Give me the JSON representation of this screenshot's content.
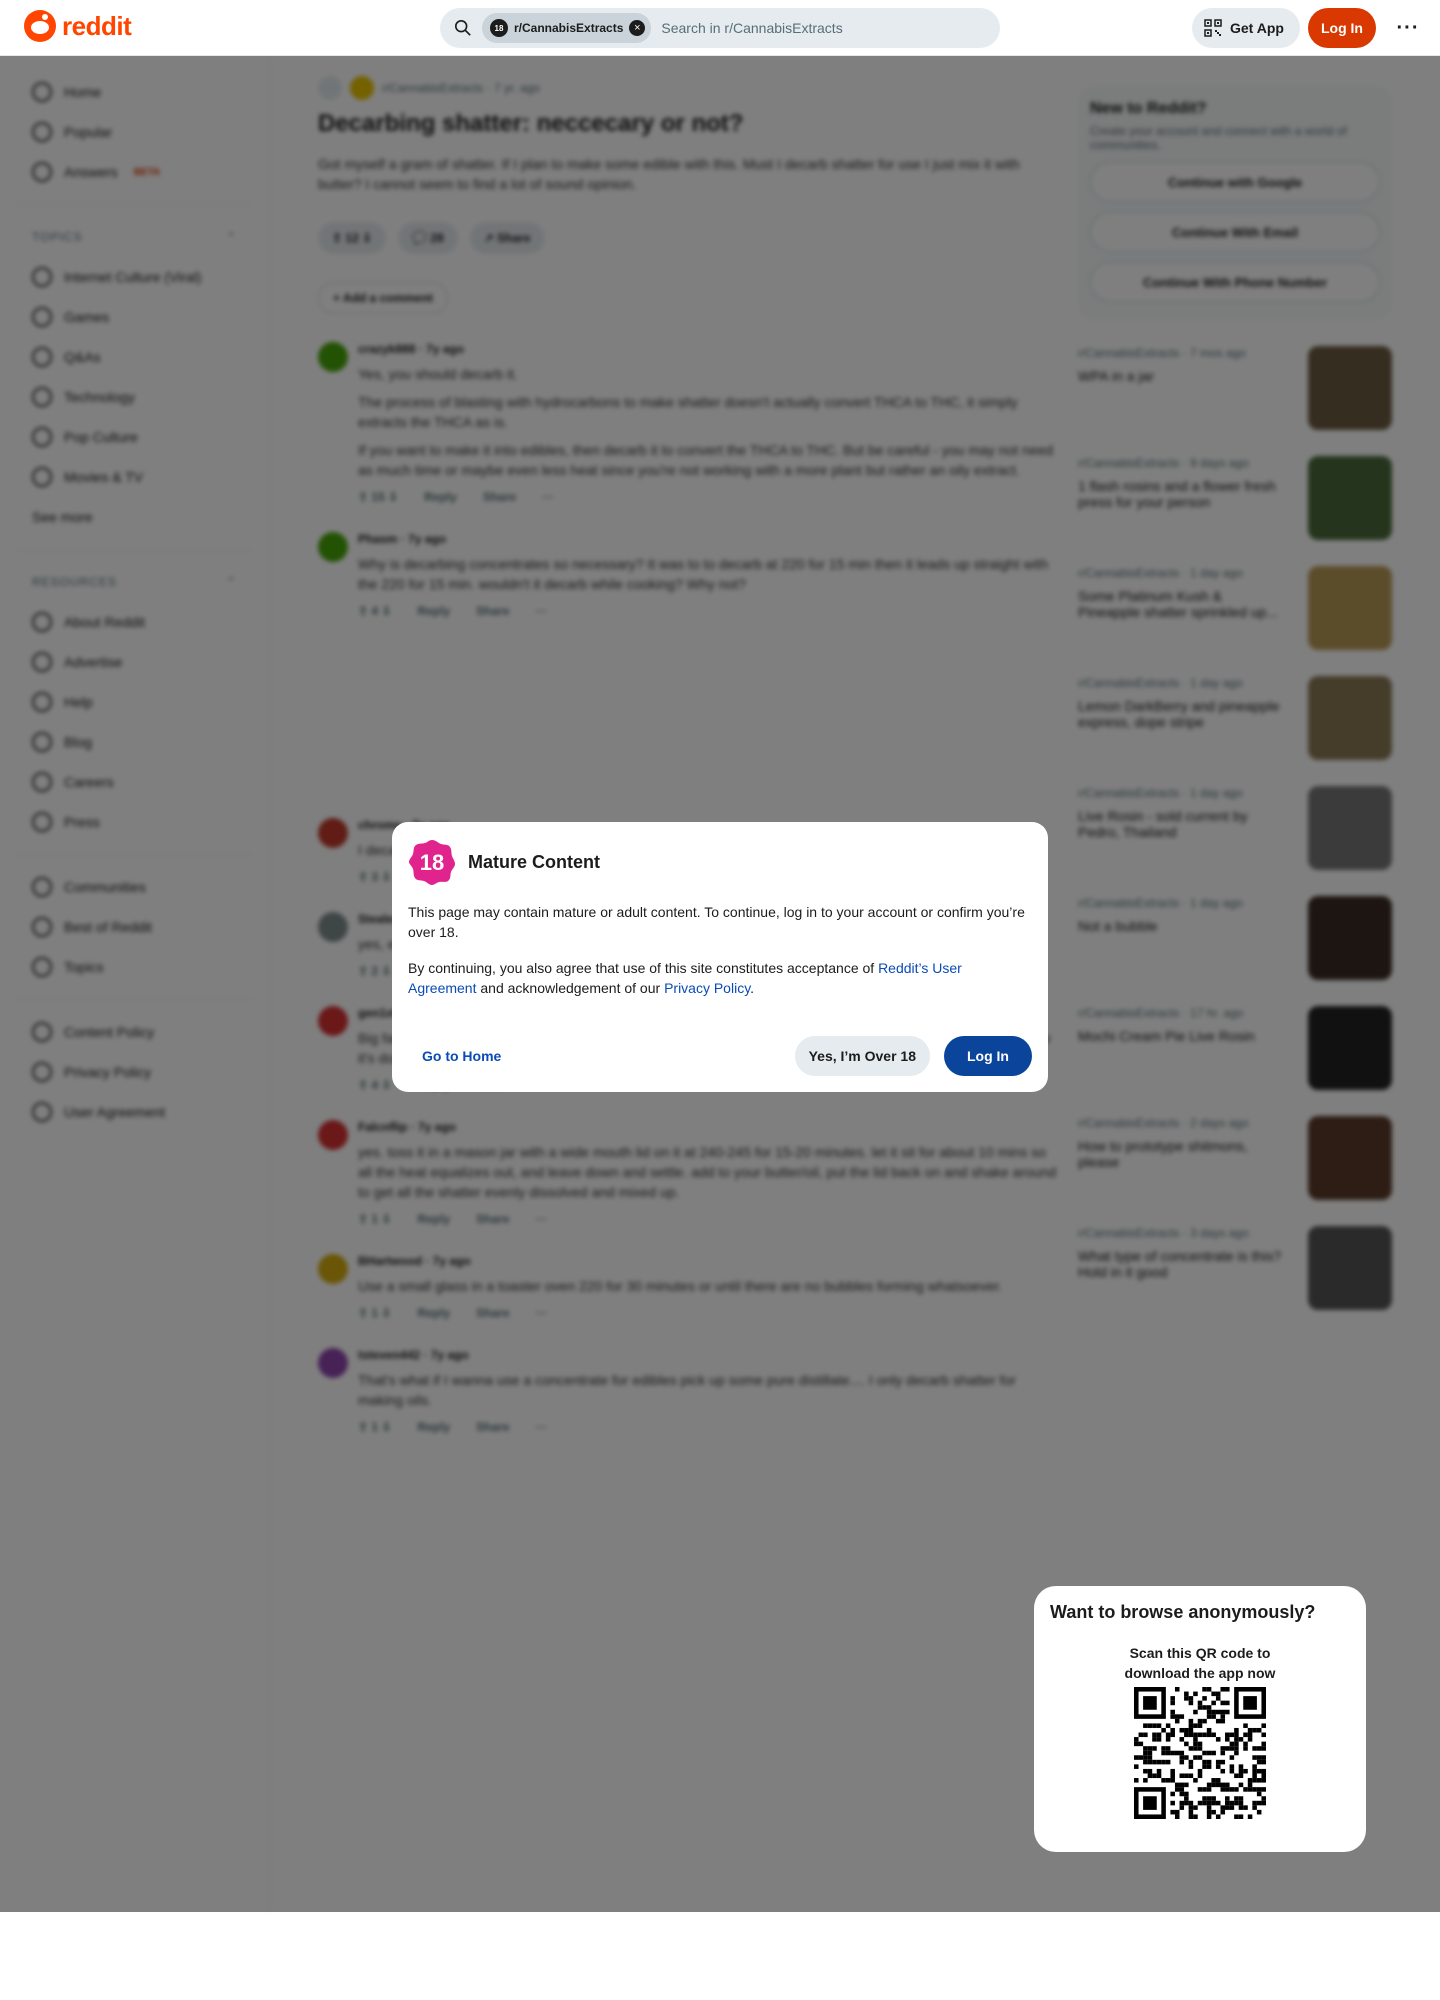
{
  "header": {
    "logo_text": "reddit",
    "search": {
      "chip_label": "r/CannabisExtracts",
      "chip_avatar": "18",
      "placeholder": "Search in r/CannabisExtracts"
    },
    "get_app_label": "Get App",
    "login_label": "Log In",
    "more_label": "···"
  },
  "modal": {
    "badge": "18",
    "title": "Mature Content",
    "para1": "This page may contain mature or adult content. To continue, log in to your account or confirm you’re over 18.",
    "para2_prefix": "By continuing, you also agree that use of this site constitutes acceptance of ",
    "para2_link1": "Reddit’s User Agreement",
    "para2_mid": " and acknowledgement of our ",
    "para2_link2": "Privacy Policy",
    "para2_suffix": ".",
    "go_home": "Go to Home",
    "over18": "Yes, I’m Over 18",
    "login": "Log In"
  },
  "qr_card": {
    "title": "Want to browse anonymously?",
    "subtitle_line1": "Scan this QR code to",
    "subtitle_line2": "download the app now"
  },
  "colors": {
    "brand": "#ff4500",
    "login": "#d93900",
    "modal_login": "#0a449b",
    "link": "#0a4bb5",
    "badge18": "#e0238d"
  }
}
